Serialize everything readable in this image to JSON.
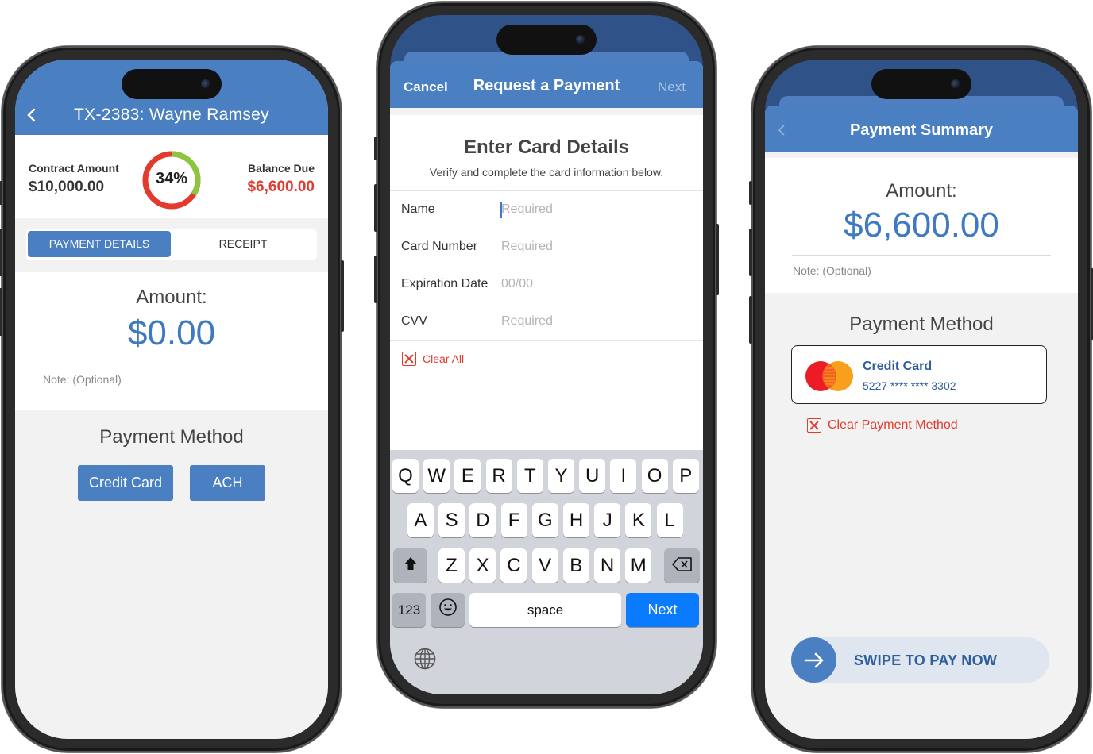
{
  "phone1": {
    "title": "TX-2383: Wayne Ramsey",
    "contract_label": "Contract Amount",
    "contract_value": "$10,000.00",
    "percent": "34%",
    "percent_value": 0.34,
    "balance_label": "Balance Due",
    "balance_value": "$6,600.00",
    "tabs": [
      "PAYMENT DETAILS",
      "RECEIPT"
    ],
    "amount_label": "Amount:",
    "amount_value": "$0.00",
    "note_placeholder": "Note: (Optional)",
    "method_title": "Payment Method",
    "method_buttons": [
      "Credit Card",
      "ACH"
    ]
  },
  "phone2": {
    "cancel": "Cancel",
    "title": "Request a Payment",
    "next": "Next",
    "heading": "Enter Card Details",
    "subheading": "Verify and complete the card information below.",
    "fields": [
      {
        "label": "Name",
        "placeholder": "Required"
      },
      {
        "label": "Card Number",
        "placeholder": "Required"
      },
      {
        "label": "Expiration Date",
        "placeholder": "00/00"
      },
      {
        "label": "CVV",
        "placeholder": "Required"
      }
    ],
    "clear_all": "Clear All",
    "keyboard": {
      "row1": [
        "Q",
        "W",
        "E",
        "R",
        "T",
        "Y",
        "U",
        "I",
        "O",
        "P"
      ],
      "row2": [
        "A",
        "S",
        "D",
        "F",
        "G",
        "H",
        "J",
        "K",
        "L"
      ],
      "row3": [
        "Z",
        "X",
        "C",
        "V",
        "B",
        "N",
        "M"
      ],
      "num_key": "123",
      "space": "space",
      "next": "Next"
    }
  },
  "phone3": {
    "title": "Payment Summary",
    "amount_label": "Amount:",
    "amount_value": "$6,600.00",
    "note_placeholder": "Note: (Optional)",
    "method_title": "Payment Method",
    "card_name": "Credit Card",
    "card_number": "5227 **** **** 3302",
    "clear_method": "Clear Payment Method",
    "swipe": "SWIPE TO PAY NOW"
  },
  "colors": {
    "brand_blue": "#4a7fc1",
    "accent_red": "#e23a2c",
    "donut_green": "#8cc63f",
    "ios_blue": "#0a7aff"
  },
  "icons": [
    "back-chevron-icon",
    "shift-icon",
    "delete-icon",
    "emoji-icon",
    "globe-icon",
    "mastercard-icon",
    "arrow-right-icon",
    "clear-x-icon"
  ]
}
